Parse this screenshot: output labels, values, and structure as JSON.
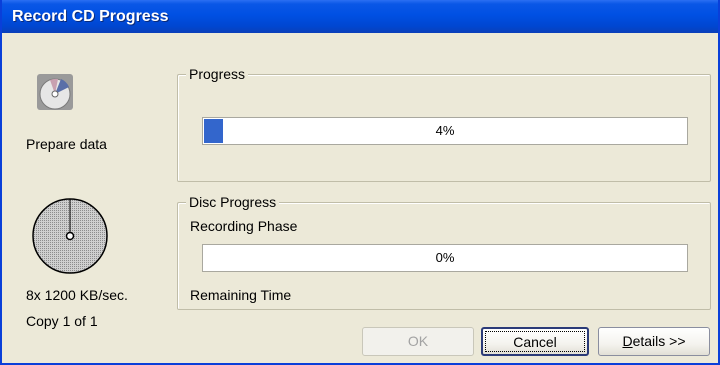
{
  "window": {
    "title": "Record CD Progress"
  },
  "left": {
    "status_label": "Prepare data",
    "speed": "8x 1200 KB/sec.",
    "copy": "Copy 1 of 1",
    "icons": [
      "cd-prepare-icon",
      "disc-icon"
    ]
  },
  "progress": {
    "legend": "Progress",
    "value_text": "4%",
    "value": 4
  },
  "disc": {
    "legend": "Disc Progress",
    "phase_label": "Recording Phase",
    "value_text": "0%",
    "value": 0,
    "remaining_label": "Remaining Time"
  },
  "buttons": {
    "ok": "OK",
    "cancel": "Cancel",
    "details_mnemonic": "D",
    "details_rest": "etails >>"
  },
  "colors": {
    "title_bar": "#0050E3",
    "progress_fill": "#3366CC",
    "window_bg": "#ECE9D8"
  }
}
